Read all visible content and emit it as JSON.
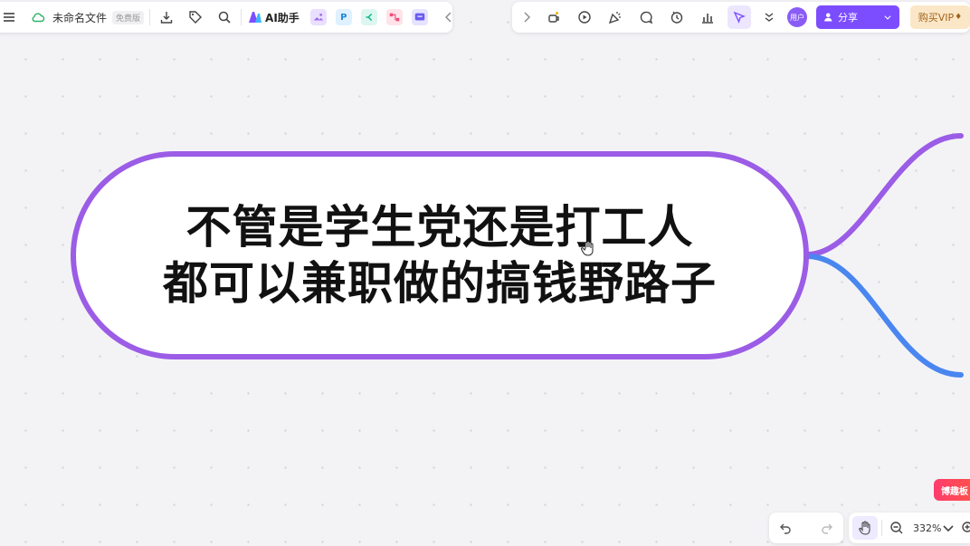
{
  "toolbar_left": {
    "file_name": "未命名文件",
    "plan_badge": "免费版",
    "ai_assistant_label": "AI助手",
    "icons": [
      "menu-icon",
      "cloud-saved-icon",
      "download-icon",
      "tag-icon",
      "search-icon",
      "ai-logo-icon",
      "image-app-icon",
      "ppt-app-icon",
      "mindmap-app-icon",
      "flowchart-app-icon",
      "chat-app-icon",
      "collapse-left-icon"
    ]
  },
  "toolbar_right": {
    "share_label": "分享",
    "buy_vip_label": "购买VIP",
    "avatar_text": "用户",
    "icons": [
      "expand-right-icon",
      "style-paint-icon",
      "play-icon",
      "celebrate-icon",
      "comment-icon",
      "history-icon",
      "statistics-icon",
      "select-cursor-icon",
      "more-chevron-icon"
    ]
  },
  "canvas": {
    "main_node": {
      "lines": [
        "不管是学生党还是打工人",
        "都可以兼职做的搞钱野路子"
      ],
      "border_color": "#9b5ce6"
    },
    "branches": [
      {
        "color": "#9b5ce6"
      },
      {
        "color": "#4a86f0"
      }
    ],
    "side_tab_label": "博趣板"
  },
  "bottom_bar": {
    "zoom_level": "332%",
    "icons": [
      "undo-icon",
      "redo-icon",
      "hand-tool-icon",
      "zoom-out-icon",
      "zoom-dropdown-icon",
      "zoom-in-icon"
    ]
  },
  "colors": {
    "accent": "#7c4dff",
    "canvas_bg": "#f3f3f6",
    "vip_bg": "#fbe7c7"
  }
}
